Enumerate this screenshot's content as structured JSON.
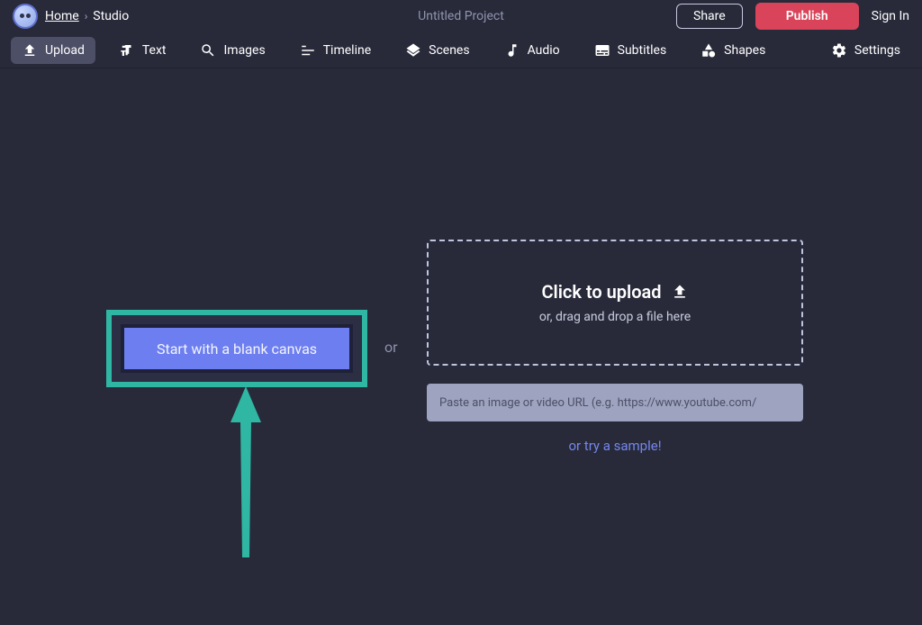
{
  "header": {
    "home_label": "Home",
    "breadcrumb_current": "Studio",
    "project_title": "Untitled Project",
    "share_label": "Share",
    "publish_label": "Publish",
    "signin_label": "Sign In"
  },
  "toolbar": {
    "upload": "Upload",
    "text": "Text",
    "images": "Images",
    "timeline": "Timeline",
    "scenes": "Scenes",
    "audio": "Audio",
    "subtitles": "Subtitles",
    "shapes": "Shapes",
    "settings": "Settings"
  },
  "stage": {
    "blank_canvas_label": "Start with a blank canvas",
    "or_label": "or",
    "dropzone_title": "Click to upload",
    "dropzone_sub": "or, drag and drop a file here",
    "url_placeholder": "Paste an image or video URL (e.g. https://www.youtube.com/",
    "try_sample_label": "or try a sample!"
  },
  "colors": {
    "accent_teal": "#2fb7a3",
    "accent_blue": "#6d7ff0",
    "accent_red": "#d9445a",
    "bg": "#282a3a"
  }
}
